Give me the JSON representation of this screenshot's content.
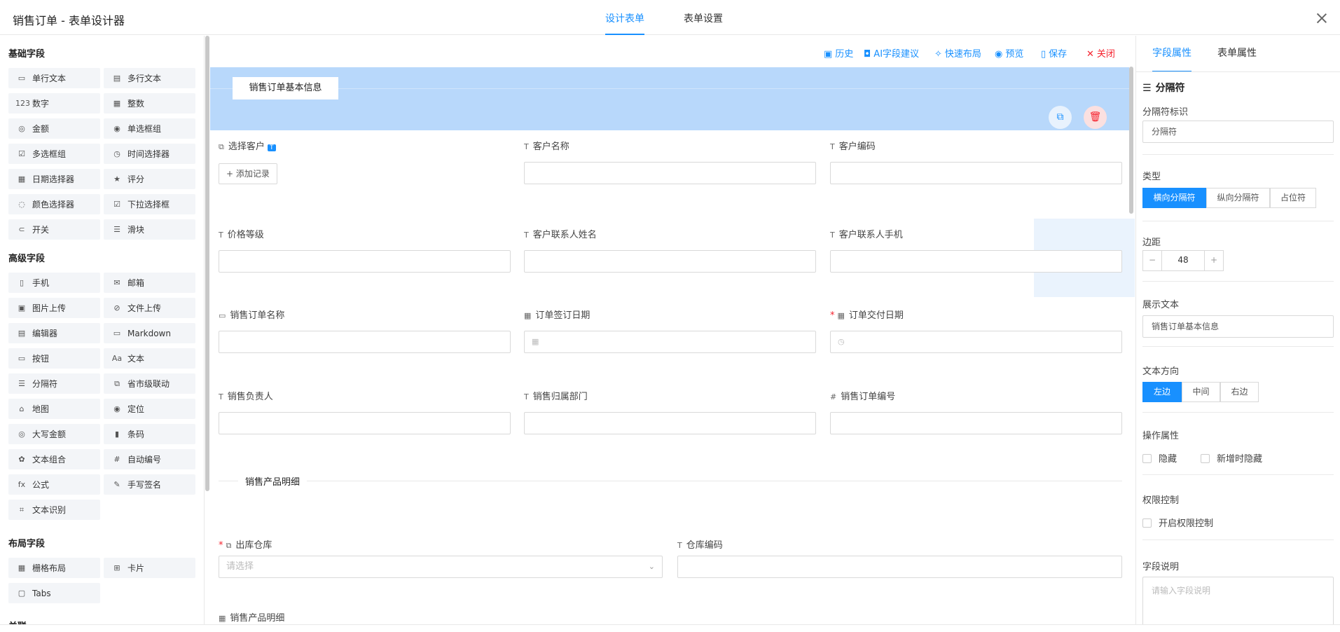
{
  "header": {
    "title": "销售订单 - 表单设计器",
    "tabs": [
      "设计表单",
      "表单设置"
    ],
    "active_tab": 0
  },
  "palette": {
    "groups": [
      {
        "title": "基础字段",
        "items": [
          {
            "label": "单行文本",
            "icon": "▭"
          },
          {
            "label": "多行文本",
            "icon": "▤"
          },
          {
            "label": "数字",
            "icon": "123"
          },
          {
            "label": "整数",
            "icon": "▦"
          },
          {
            "label": "金额",
            "icon": "◎"
          },
          {
            "label": "单选框组",
            "icon": "◉"
          },
          {
            "label": "多选框组",
            "icon": "☑"
          },
          {
            "label": "时间选择器",
            "icon": "◷"
          },
          {
            "label": "日期选择器",
            "icon": "▦"
          },
          {
            "label": "评分",
            "icon": "★"
          },
          {
            "label": "颜色选择器",
            "icon": "◌"
          },
          {
            "label": "下拉选择框",
            "icon": "☑"
          },
          {
            "label": "开关",
            "icon": "⊂"
          },
          {
            "label": "滑块",
            "icon": "☰"
          }
        ]
      },
      {
        "title": "高级字段",
        "items": [
          {
            "label": "手机",
            "icon": "▯"
          },
          {
            "label": "邮箱",
            "icon": "✉"
          },
          {
            "label": "图片上传",
            "icon": "▣"
          },
          {
            "label": "文件上传",
            "icon": "⊘"
          },
          {
            "label": "编辑器",
            "icon": "▤"
          },
          {
            "label": "Markdown",
            "icon": "▭"
          },
          {
            "label": "按钮",
            "icon": "▭"
          },
          {
            "label": "文本",
            "icon": "Aa"
          },
          {
            "label": "分隔符",
            "icon": "☰"
          },
          {
            "label": "省市级联动",
            "icon": "⧉"
          },
          {
            "label": "地图",
            "icon": "⌂"
          },
          {
            "label": "定位",
            "icon": "◉"
          },
          {
            "label": "大写金额",
            "icon": "◎"
          },
          {
            "label": "条码",
            "icon": "▮"
          },
          {
            "label": "文本组合",
            "icon": "✿"
          },
          {
            "label": "自动编号",
            "icon": "#"
          },
          {
            "label": "公式",
            "icon": "fx"
          },
          {
            "label": "手写签名",
            "icon": "✎"
          },
          {
            "label": "文本识别",
            "icon": "⌗"
          }
        ]
      },
      {
        "title": "布局字段",
        "items": [
          {
            "label": "栅格布局",
            "icon": "▦"
          },
          {
            "label": "卡片",
            "icon": "⊞"
          },
          {
            "label": "Tabs",
            "icon": "▢"
          }
        ]
      },
      {
        "title": "关联",
        "items": []
      }
    ]
  },
  "toolbar": {
    "items": [
      {
        "label": "历史",
        "icon": "▣"
      },
      {
        "label": "AI字段建议",
        "icon": "◘"
      },
      {
        "label": "快速布局",
        "icon": "✧"
      },
      {
        "label": "预览",
        "icon": "◉"
      },
      {
        "label": "保存",
        "icon": "▯"
      },
      {
        "label": "关闭",
        "icon": "✕"
      }
    ]
  },
  "canvas": {
    "divider_text": "销售订单基本信息",
    "select_customer": {
      "label": "选择客户",
      "badge": "T",
      "add_record": "+ 添加记录"
    },
    "fields": {
      "customer_name": "客户名称",
      "customer_code": "客户编码",
      "price_level": "价格等级",
      "contact_name": "客户联系人姓名",
      "contact_phone": "客户联系人手机",
      "order_name": "销售订单名称",
      "sign_date": "订单签订日期",
      "delivery_date": "订单交付日期",
      "owner": "销售负责人",
      "department": "销售归属部门",
      "order_no": "销售订单编号"
    },
    "section2_title": "销售产品明细",
    "warehouse": {
      "label": "出库仓库",
      "placeholder": "请选择"
    },
    "warehouse_code": "仓库编码",
    "subtable_title": "销售产品明细"
  },
  "props": {
    "tabs": [
      "字段属性",
      "表单属性"
    ],
    "active_tab": 0,
    "component_title": "分隔符",
    "id_label": "分隔符标识",
    "id_value": "分隔符",
    "type_label": "类型",
    "type_options": [
      "横向分隔符",
      "纵向分隔符",
      "占位符"
    ],
    "type_selected": 0,
    "margin_label": "边距",
    "margin_value": "48",
    "minus": "−",
    "plus": "+",
    "display_text_label": "展示文本",
    "display_text_value": "销售订单基本信息",
    "direction_label": "文本方向",
    "direction_options": [
      "左边",
      "中间",
      "右边"
    ],
    "direction_selected": 0,
    "ops_label": "操作属性",
    "hide_label": "隐藏",
    "hide_on_new_label": "新增时隐藏",
    "perm_label": "权限控制",
    "perm_enable_label": "开启权限控制",
    "desc_label": "字段说明",
    "desc_placeholder": "请输入字段说明"
  },
  "colors": {
    "accent": "#1890ff",
    "selected_bg": "#b8d8fb",
    "danger": "#f5222d"
  }
}
